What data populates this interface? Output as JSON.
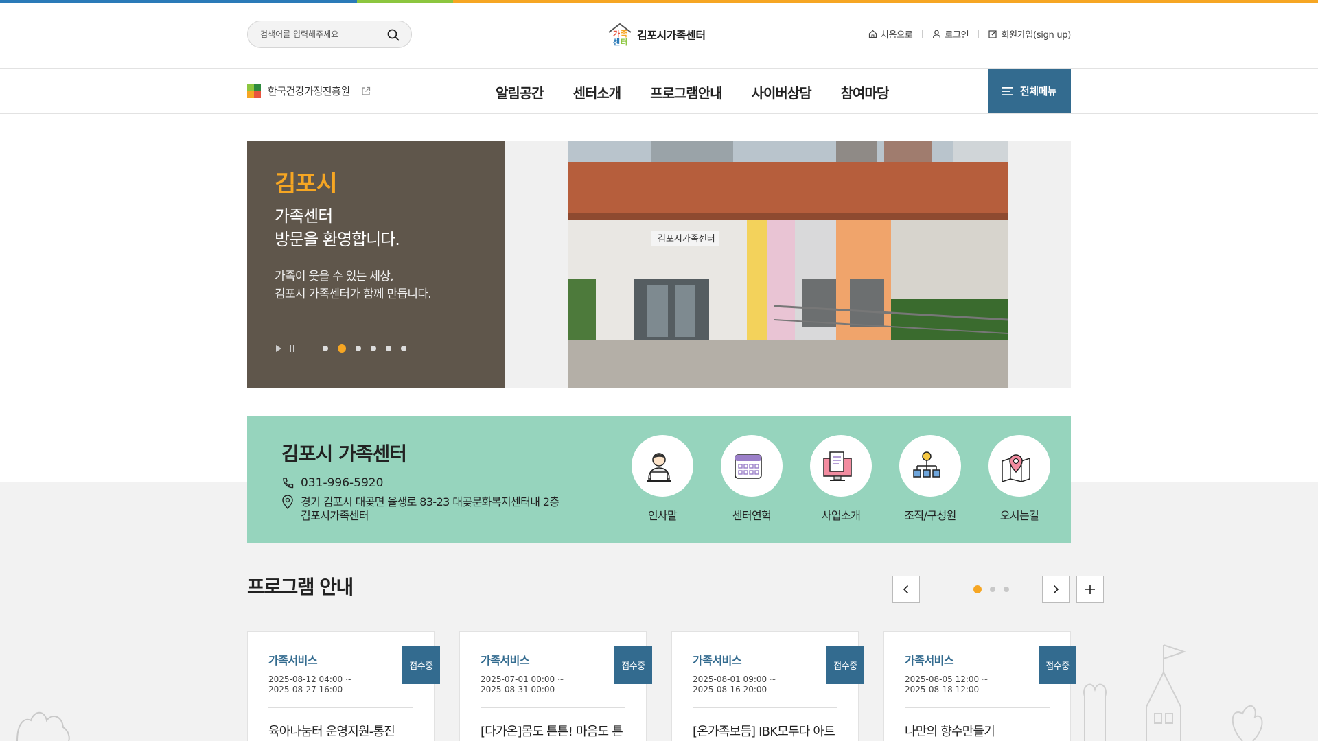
{
  "colors": {
    "topbar": [
      "#2a7ab8",
      "#8cc63f",
      "#f6a623"
    ],
    "primary": "#336b8f",
    "accent": "#f6a623",
    "hero_bg": "#5f564b",
    "info_bg": "#96d4bd"
  },
  "header": {
    "search_placeholder": "검색어를 입력해주세요",
    "logo_text": "김포시가족센터",
    "util": {
      "home": "처음으로",
      "login": "로그인",
      "signup": "회원가입(sign up)"
    }
  },
  "gnb": {
    "org_link": "한국건강가정진흥원",
    "menu": [
      "알림공간",
      "센터소개",
      "프로그램안내",
      "사이버상담",
      "참여마당"
    ],
    "all_menu": "전체메뉴"
  },
  "hero": {
    "title_accent": "김포시",
    "title": "가족센터\n방문을 환영합니다.",
    "desc": "가족이 웃을 수 있는 세상,\n김포시 가족센터가 함께 만듭니다.",
    "slide_count": 6,
    "active_slide": 2,
    "photo_sign": "김포시가족센터"
  },
  "info": {
    "name": "김포시 가족센터",
    "phone": "031-996-5920",
    "address": "경기 김포시 대곶면 율생로 83-23 대곶문화복지센터내 2층\n김포시가족센터",
    "quick_links": [
      {
        "label": "인사말",
        "icon": "person-laptop-icon"
      },
      {
        "label": "센터연혁",
        "icon": "calendar-icon"
      },
      {
        "label": "사업소개",
        "icon": "monitor-document-icon"
      },
      {
        "label": "조직/구성원",
        "icon": "org-chart-icon"
      },
      {
        "label": "오시는길",
        "icon": "map-pin-icon"
      }
    ]
  },
  "programs": {
    "title": "프로그램 안내",
    "page_count": 3,
    "active_page": 1,
    "cards": [
      {
        "category": "가족서비스",
        "date": "2025-08-12 04:00 ~\n2025-08-27 16:00",
        "title": "육아나눔터 운영지원-통진",
        "badge": "접수중"
      },
      {
        "category": "가족서비스",
        "date": "2025-07-01 00:00 ~\n2025-08-31 00:00",
        "title": "[다가온]몸도 튼튼! 마음도 튼",
        "badge": "접수중"
      },
      {
        "category": "가족서비스",
        "date": "2025-08-01 09:00 ~\n2025-08-16 20:00",
        "title": "[온가족보듬] IBK모두다 아트",
        "badge": "접수중"
      },
      {
        "category": "가족서비스",
        "date": "2025-08-05 12:00 ~\n2025-08-18 12:00",
        "title": "나만의 향수만들기",
        "badge": "접수중"
      }
    ]
  }
}
